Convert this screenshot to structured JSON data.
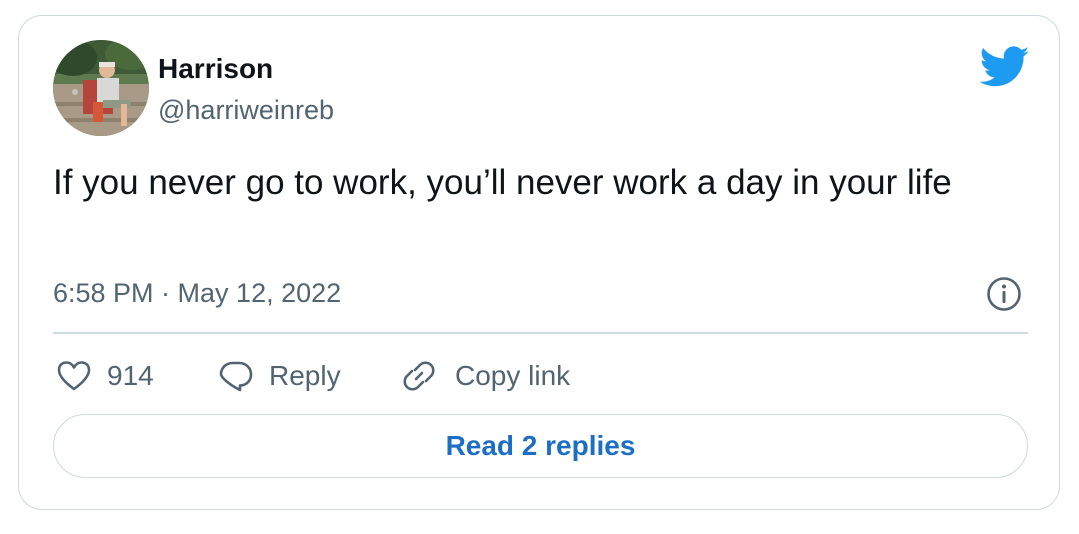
{
  "author": {
    "display_name": "Harrison",
    "handle": "@harriweinreb",
    "avatar_icon": "profile-photo-avatar"
  },
  "tweet": {
    "text": "If you never go to work, you’ll never work a day in your life",
    "timestamp": "6:58 PM · May 12, 2022"
  },
  "actions": {
    "like_count": "914",
    "reply_label": "Reply",
    "copy_link_label": "Copy link"
  },
  "read_replies_label": "Read 2 replies",
  "icons": {
    "brand": "twitter-bird-icon",
    "info": "info-icon",
    "like": "heart-icon",
    "reply": "speech-bubble-icon",
    "copy": "link-icon"
  },
  "colors": {
    "brand_blue": "#1d9bf0",
    "link_blue": "#1d6fc6",
    "text_primary": "#0f1419",
    "text_secondary": "#536471",
    "border": "#cfd9de"
  }
}
